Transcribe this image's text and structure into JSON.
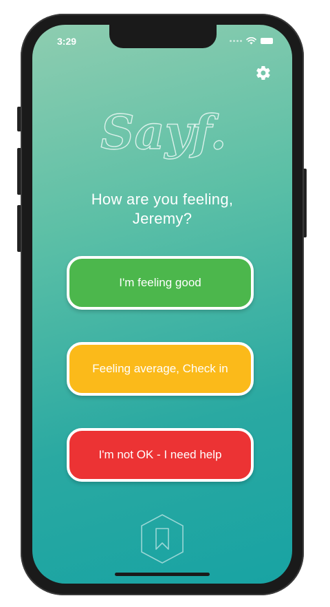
{
  "status_bar": {
    "time": "3:29"
  },
  "header": {
    "settings_icon": "gear-icon",
    "logo_text": "Sayf."
  },
  "greeting": {
    "line1": "How are you feeling,",
    "line2": "Jeremy?"
  },
  "mood_options": [
    {
      "label": "I'm feeling good",
      "color": "#4cb74c"
    },
    {
      "label": "Feeling average, Check in",
      "color": "#fbba1a"
    },
    {
      "label": "I'm not OK - I need help",
      "color": "#ec3334"
    }
  ],
  "footer": {
    "icon": "bookmark-hexagon-icon"
  },
  "colors": {
    "gradient_top": "#8ecdb0",
    "gradient_bottom": "#18a3a3",
    "text": "#ffffff"
  }
}
